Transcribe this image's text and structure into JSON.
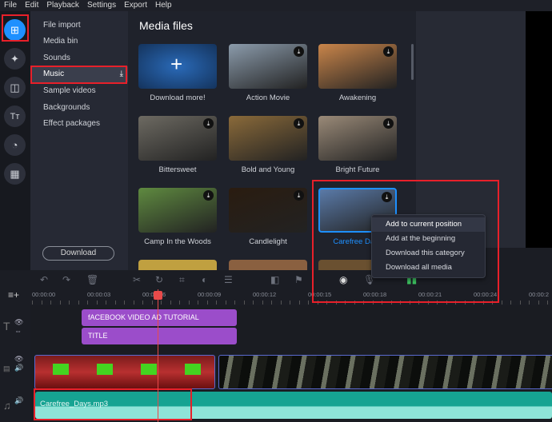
{
  "menu": [
    "File",
    "Edit",
    "Playback",
    "Settings",
    "Export",
    "Help"
  ],
  "sidebar_icons": [
    "import-icon",
    "magic-wand-icon",
    "transition-icon",
    "titles-icon",
    "stickers-icon",
    "more-icon"
  ],
  "categories": {
    "items": [
      "File import",
      "Media bin",
      "Sounds",
      "Music",
      "Sample videos",
      "Backgrounds",
      "Effect packages"
    ],
    "selected": "Music",
    "download_label": "Download"
  },
  "media": {
    "title": "Media files",
    "items": [
      {
        "label": "Download more!",
        "color": "#1d4f8f"
      },
      {
        "label": "Action Movie",
        "color": "#8b9bab"
      },
      {
        "label": "Awakening",
        "color": "#c9854a"
      },
      {
        "label": "Bittersweet",
        "color": "#6d6a62"
      },
      {
        "label": "Bold and Young",
        "color": "#8a6a3a"
      },
      {
        "label": "Bright Future",
        "color": "#9a8a78"
      },
      {
        "label": "Camp In the Woods",
        "color": "#5f8a40"
      },
      {
        "label": "Candlelight",
        "color": "#2a1c10"
      },
      {
        "label": "Carefree Days",
        "color": "#5a7aa8",
        "selected": true
      }
    ]
  },
  "context_menu": [
    "Add to current position",
    "Add at the beginning",
    "Download this category",
    "Download all media"
  ],
  "ruler": [
    "00:00:00",
    "00:00:03",
    "00:00:06",
    "00:00:09",
    "00:00:12",
    "00:00:15",
    "00:00:18",
    "00:00:21",
    "00:00:24",
    "00:00:2"
  ],
  "timeline": {
    "title_clips": [
      "fACEBOOK VIDEO AD TUTORIAL",
      "TITLE"
    ],
    "audio_clip": "Carefree_Days.mp3"
  },
  "colors": {
    "accent": "#1e90ff",
    "highlight": "#e8202a",
    "title_clip": "#9b4dca",
    "audio": "#16a392",
    "playhead": "#e84a4a"
  }
}
